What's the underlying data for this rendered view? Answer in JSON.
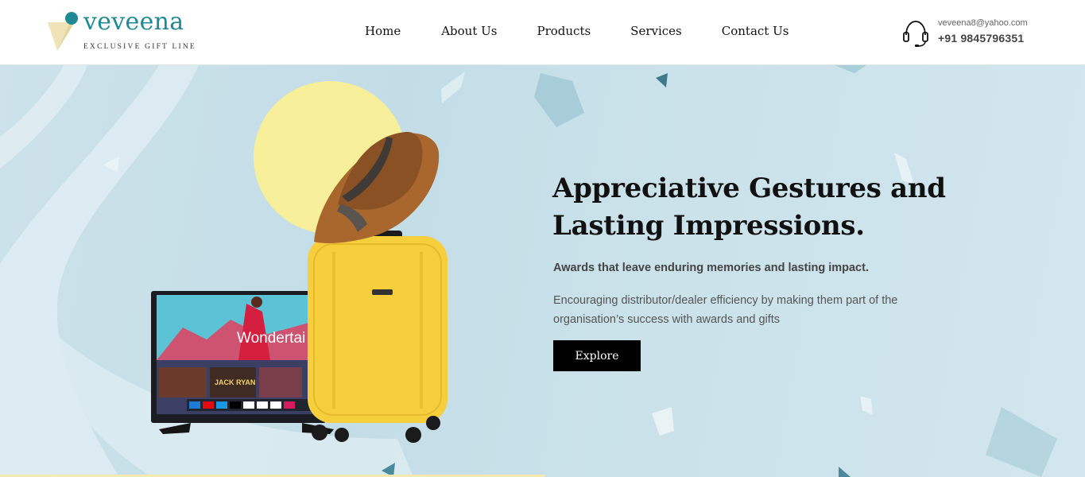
{
  "brand": {
    "name": "veveena",
    "tagline": "EXCLUSIVE GIFT LINE",
    "primary_color": "#1e8a95",
    "accent_color": "#f3e6b3"
  },
  "nav": {
    "items": [
      {
        "label": "Home"
      },
      {
        "label": "About Us"
      },
      {
        "label": "Products"
      },
      {
        "label": "Services"
      },
      {
        "label": "Contact Us"
      }
    ]
  },
  "contact": {
    "icon": "headset-icon",
    "email": "veveena8@yahoo.com",
    "phone": "+91 9845796351"
  },
  "hero": {
    "title": "Appreciative Gestures and Lasting Impressions.",
    "subtitle": "Awards that leave enduring memories and lasting impact.",
    "description": "Encouraging distributor/dealer efficiency by making them part of the organisation’s success with awards and gifts",
    "button_label": "Explore",
    "tv_screen_text": "Wondertai",
    "tv_tile_text": "JACK RYAN",
    "background_color": "#c7dfe8",
    "suitcase_color": "#f7cf3c",
    "sun_color": "#f8ef9a"
  }
}
